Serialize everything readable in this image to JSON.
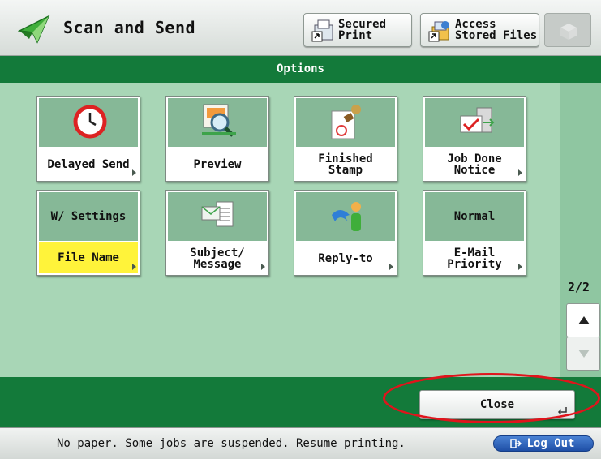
{
  "header": {
    "title": "Scan and Send",
    "secured_print_label": "Secured\nPrint",
    "access_files_label": "Access\nStored Files"
  },
  "options_bar": {
    "title": "Options"
  },
  "tiles": [
    {
      "label": "Delayed Send",
      "has_arrow": true,
      "icon": "clock-icon"
    },
    {
      "label": "Preview",
      "has_arrow": false,
      "icon": "magnifier-icon"
    },
    {
      "label": "Finished\nStamp",
      "has_arrow": false,
      "icon": "stamp-icon"
    },
    {
      "label": "Job Done\nNotice",
      "has_arrow": true,
      "icon": "mail-check-icon"
    },
    {
      "label": "File Name",
      "top_text": "W/ Settings",
      "has_arrow": true,
      "highlighted": true
    },
    {
      "label": "Subject/\nMessage",
      "has_arrow": true,
      "icon": "envelope-document-icon"
    },
    {
      "label": "Reply-to",
      "has_arrow": true,
      "icon": "reply-person-icon"
    },
    {
      "label": "E-Mail\nPriority",
      "top_text": "Normal",
      "has_arrow": true
    }
  ],
  "pagination": {
    "indicator": "2/2"
  },
  "close_button": {
    "label": "Close"
  },
  "status": {
    "message": "No paper. Some jobs are suspended. Resume printing."
  },
  "logout": {
    "label": "Log Out"
  },
  "colors": {
    "accent_green": "#137a3a",
    "panel_green": "#a8d6b6",
    "tile_top": "#86b897",
    "highlight_yellow": "#fff33a",
    "annotation_red": "#e0141c",
    "logout_blue": "#1f4fa6"
  }
}
